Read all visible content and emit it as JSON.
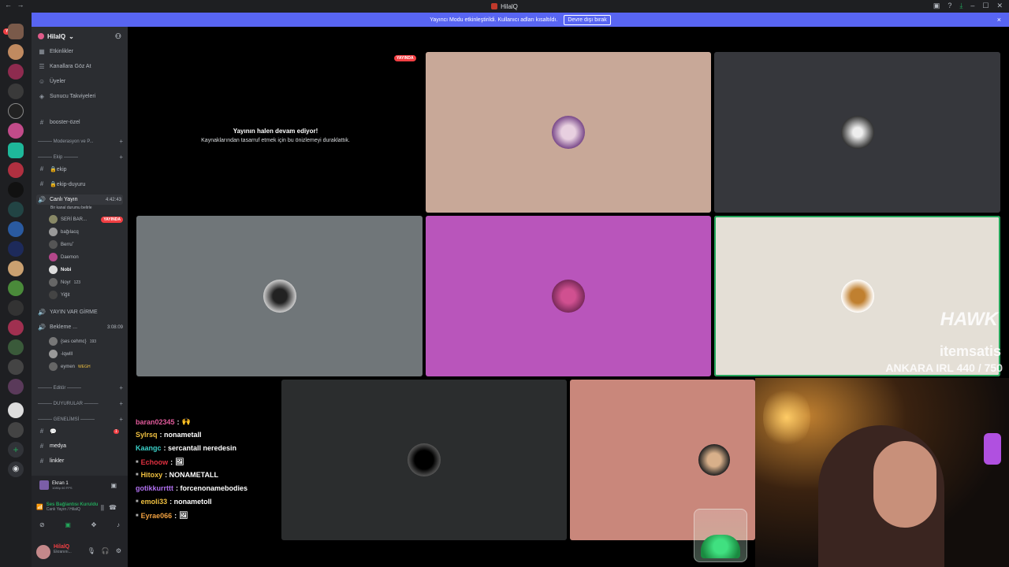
{
  "titlebar": {
    "title": "HilalQ"
  },
  "banner": {
    "message": "Yayıncı Modu etkinleştirildi. Kullanıcı adları kısaltıldı.",
    "button": "Devre dışı bırak",
    "close": "×"
  },
  "servers": {
    "new_badge": "YENİ",
    "icons": [
      "server-1",
      "server-2",
      "server-3",
      "server-4",
      "server-5",
      "server-6",
      "server-7",
      "server-8",
      "server-9",
      "server-10",
      "server-11",
      "server-12",
      "server-13",
      "server-14",
      "server-15",
      "server-16",
      "server-17",
      "server-18",
      "server-19",
      "server-20",
      "server-21"
    ]
  },
  "sidebar": {
    "server_name": "HilalQ",
    "top_items": [
      {
        "label": "Etkinlikler",
        "icon": "calendar-icon"
      },
      {
        "label": "Kanallara Göz At",
        "icon": "browse-icon"
      },
      {
        "label": "Üyeler",
        "icon": "members-icon"
      },
      {
        "label": "Sunucu Takviyeleri",
        "icon": "boost-icon"
      }
    ],
    "booster": "booster-özel",
    "cat_moderasyon": "——— Moderasyon ve P...",
    "cat_ekip": "——— Ekip ———",
    "ch_ekip": "🔒ekip",
    "ch_ekip_duyuru": "🔒ekip-duyuru",
    "voice_live": {
      "name": "Canlı Yayın",
      "time": "4:42:43",
      "status": "Bir kanal durumu belirle",
      "users": [
        {
          "name": "SERİ BAR...",
          "live": "YAYINDA"
        },
        {
          "name": "bağılacq"
        },
        {
          "name": "Berru˚"
        },
        {
          "name": "Daemon"
        },
        {
          "name": "Nobi"
        },
        {
          "name": "Noyr",
          "tag": "123"
        },
        {
          "name": "Yiğit"
        }
      ]
    },
    "yayin_var": "YAYIN VAR GİRME",
    "voice_wait": {
      "name": "Bekleme ...",
      "time": "3:08:09",
      "users": [
        {
          "name": "{ses cehmc}",
          "tag": "193"
        },
        {
          "name": "-lqwlll"
        },
        {
          "name": "eymen",
          "tag": "WEGH"
        }
      ]
    },
    "cat_editor": "——— Editör ———",
    "cat_duyurular": "——— DUYURULAR ———",
    "cat_genelimsi": "——— GENELİMSİ ———",
    "ch_bubble": "💬",
    "ch_medya": "medya",
    "ch_linkler": "linkler",
    "unread": "1"
  },
  "screen_share": {
    "title": "Ekran 1",
    "quality": "1080p 60 FPS"
  },
  "voice_status": {
    "title": "Ses Bağlantısı Kuruldu",
    "channel": "Canlı Yayın / HilalQ"
  },
  "user_panel": {
    "name": "HilalQ",
    "status": "Ekranını..."
  },
  "stage": {
    "live_badge": "YAYINDA",
    "paused_title": "Yayının halen devam ediyor!",
    "paused_sub": "Kaynaklarından tasarruf etmek için bu önizlemeyi duraklattık.",
    "tiles": [
      {
        "name": "tile-participant-1",
        "bg": "#c8a898"
      },
      {
        "name": "tile-participant-2",
        "bg": "#36373c"
      },
      {
        "name": "tile-participant-3",
        "bg": "#707679"
      },
      {
        "name": "tile-participant-4",
        "bg": "#b955bb"
      },
      {
        "name": "tile-participant-5",
        "bg": "#e4dfd6"
      },
      {
        "name": "tile-participant-6",
        "bg": "#2b2d2e"
      },
      {
        "name": "tile-participant-7",
        "bg": "#c9877b"
      }
    ]
  },
  "chat": [
    {
      "user": "baran02345",
      "text": ":",
      "color": "#e05a9a",
      "emote": "🙌"
    },
    {
      "user": "Sylrsq",
      "text": ": nonametall",
      "color": "#f0c040"
    },
    {
      "user": "Kaangc",
      "text": ": sercantall neredesin",
      "color": "#3bd0c8"
    },
    {
      "user": "Echoow",
      "text": ":",
      "color": "#e03040",
      "emote": "🖼"
    },
    {
      "user": "Hitoxy",
      "text": ": NONAMETALL",
      "color": "#f0c040"
    },
    {
      "user": "gotikkurrttt",
      "text": ": forcenonamebodies",
      "color": "#b070f0"
    },
    {
      "user": "emoli33",
      "text": ": nonametoll",
      "color": "#f0c040"
    },
    {
      "user": "Eyrae066",
      "text": ":",
      "color": "#f0a040",
      "emote": "🖼"
    }
  ],
  "overlay": {
    "brand1": "HAWK",
    "brand2": "itemsatis",
    "counter": "ANKARA IRL 440 / 750"
  },
  "colors": {
    "accent": "#5865f2",
    "live": "#f23f43",
    "online": "#23a55a"
  }
}
